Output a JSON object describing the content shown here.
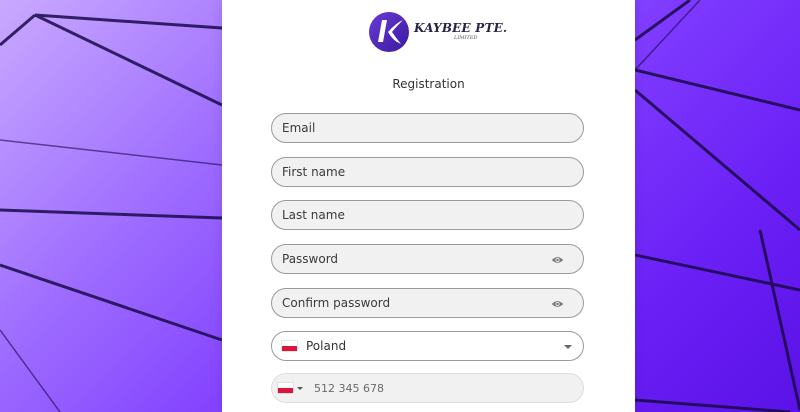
{
  "brand": {
    "name": "KAYBEE PTE.",
    "subtitle": "LIMITED"
  },
  "form": {
    "title": "Registration",
    "email_placeholder": "Email",
    "first_name_placeholder": "First name",
    "last_name_placeholder": "Last name",
    "password_placeholder": "Password",
    "confirm_password_placeholder": "Confirm password",
    "country": {
      "selected": "Poland",
      "flag": "poland-flag"
    },
    "phone": {
      "placeholder": "512 345 678",
      "flag": "poland-flag"
    }
  },
  "icons": {
    "password_toggle": "eye-icon",
    "dropdown": "chevron-down-icon"
  },
  "colors": {
    "background_start": "#c9a9ff",
    "background_end": "#5a12e6",
    "field_bg": "#f1f1f1",
    "field_border": "#9a9a9a",
    "flag_red": "#dc143c"
  }
}
